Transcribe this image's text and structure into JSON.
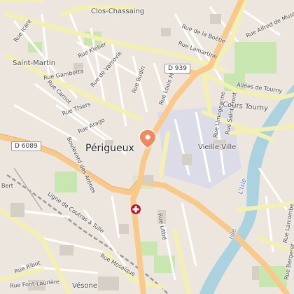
{
  "map": {
    "place_labels": {
      "city": "Périgueux",
      "saint_martin": "Saint-Martin",
      "clos_chassaing": "Clos-Chassaing",
      "vieille_ville": "Vieille Ville",
      "vesone": "Vésone"
    },
    "street_labels": {
      "rue_icare": "Rue Icare",
      "rue_bertran": "Rue Bertran",
      "rue_kleber": "Rue Kléber",
      "rue_de_varsovie": "Rue de Varsovie",
      "rue_gambetta": "Rue Gambetta",
      "rue_carnot": "Rue Carnot",
      "rue_thiers": "Rue Thiers",
      "rue_arago": "Rue Arago",
      "rue_budin": "Rue Budin",
      "rue_louis_mie": "Rue Louis Mie",
      "rue_de_la_boetie": "Rue de la Boétie",
      "rue_lamartine": "Rue Lamartine",
      "rue_alfred_de_musset": "Rue Alfred de Musset",
      "allees_de_tourny": "Allées de Tourny",
      "cours_tourny": "Cours Tourny",
      "rue_limogeanne": "Rue Limogeanne",
      "rue_saint_front": "Rue Saint-Front",
      "boulevard_des_arenes": "Boulevard des Arènes",
      "rue_lafon": "Rue Lafon",
      "rue_bert": "Bert",
      "ligne_coutras_tulle": "Ligne de Coutras à Tulle",
      "rue_mosaique": "Rue Mosaïque",
      "rue_ribot": "Rue Ribot",
      "rue_font_lauriere": "Rue Font-Laurière",
      "rue_larcombe": "Rue Larcombe",
      "rue_bergeret": "Rue Bergeret",
      "rue_lattre": "Rue Littré"
    },
    "road_shields": {
      "d939": "D 939",
      "d6089": "D 6089"
    },
    "river_label": "L'Isle",
    "river_label_2": "Isle",
    "markers": {
      "location_pin": {
        "icon": "location-pin-icon",
        "color": "#f08a5d"
      },
      "hospital": {
        "icon": "hospital-cross-icon",
        "color": "#b5122c"
      }
    },
    "colors": {
      "background": "#ece6de",
      "major_road": "#fcd6a4",
      "secondary_road": "#f7fabf",
      "park": "#c8e6b0",
      "water": "#aad3df",
      "old_town": "#dcdcf0"
    }
  }
}
